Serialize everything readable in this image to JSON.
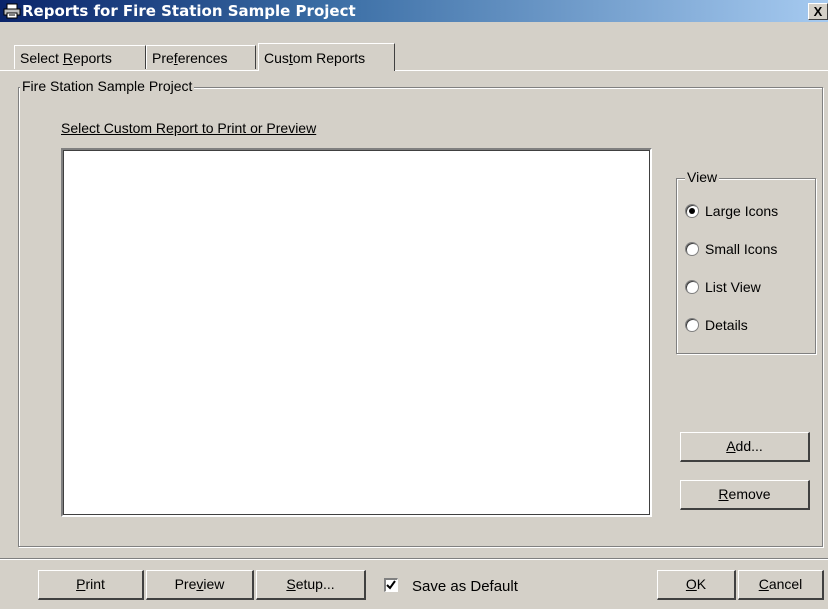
{
  "window": {
    "title": "Reports for Fire Station Sample Project",
    "close_label": "X"
  },
  "tabs": [
    {
      "pre": "Select ",
      "ul": "R",
      "post": "eports",
      "active": false
    },
    {
      "pre": "Pre",
      "ul": "f",
      "post": "erences",
      "active": false
    },
    {
      "pre": "Cus",
      "ul": "t",
      "post": "om Reports",
      "active": true
    }
  ],
  "project_group": {
    "label": "Fire Station Sample Project"
  },
  "report_list": {
    "label": "Select Custom Report to Print or Preview",
    "items": []
  },
  "view_group": {
    "label": "View",
    "options": [
      {
        "label": "Large Icons",
        "selected": true
      },
      {
        "label": "Small Icons",
        "selected": false
      },
      {
        "label": "List View",
        "selected": false
      },
      {
        "label": "Details",
        "selected": false
      }
    ]
  },
  "buttons": {
    "add": {
      "ul": "A",
      "post": "dd..."
    },
    "remove": {
      "ul": "R",
      "post": "emove"
    },
    "print": {
      "ul": "P",
      "post": "rint"
    },
    "preview": {
      "pre": "Pre",
      "ul": "v",
      "post": "iew"
    },
    "setup": {
      "ul": "S",
      "post": "etup..."
    },
    "ok": {
      "ul": "O",
      "post": "K"
    },
    "cancel": {
      "ul": "C",
      "post": "ancel"
    }
  },
  "save_default": {
    "label": "Save as Default",
    "checked": true
  }
}
